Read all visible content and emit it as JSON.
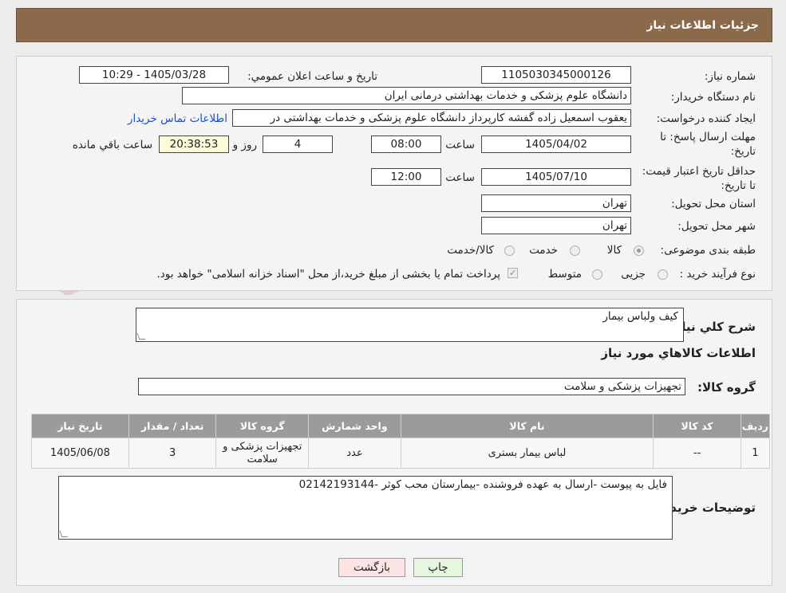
{
  "header": {
    "title": "جزئیات اطلاعات نیاز"
  },
  "form": {
    "need_number_label": "شماره نیاز:",
    "need_number": "1105030345000126",
    "announce_label": "تاریخ و ساعت اعلان عمومي:",
    "announce_value": "1405/03/28 - 10:29",
    "buyer_org_label": "نام دستگاه خریدار:",
    "buyer_org": "دانشگاه علوم پزشکی و خدمات بهداشتی درمانی ایران",
    "creator_label": "ایجاد کننده درخواست:",
    "creator": "یعقوب اسمعیل زاده گفشه کارپرداز دانشگاه علوم پزشکی و خدمات بهداشتی در",
    "contact_link": "اطلاعات تماس خریدار",
    "reply_deadline_label": "مهلت ارسال پاسخ: تا تاریخ:",
    "reply_date": "1405/04/02",
    "time_label": "ساعت",
    "reply_time": "08:00",
    "days": "4",
    "days_label": "روز و",
    "remaining_time": "20:38:53",
    "remaining_label": "ساعت باقي مانده",
    "price_validity_label": "حداقل تاریخ اعتبار قیمت: تا تاریخ:",
    "validity_date": "1405/07/10",
    "validity_time": "12:00",
    "province_label": "استان محل تحویل:",
    "province": "تهران",
    "city_label": "شهر محل تحویل:",
    "city": "تهران",
    "category_label": "طبقه بندی موضوعی:",
    "category_options": [
      "کالا",
      "خدمت",
      "کالا/خدمت"
    ],
    "process_label": "نوع فرآیند خرید :",
    "process_options": [
      "جزیی",
      "متوسط"
    ],
    "payment_note": "پرداخت تمام یا بخشی از مبلغ خرید،از محل \"اسناد خزانه اسلامی\" خواهد بود."
  },
  "details": {
    "summary_label": "شرح کلي نیاز:",
    "summary": "کیف ولباس بیمار",
    "goods_info_title": "اطلاعات کالاهاي مورد نیاز",
    "group_label": "گروه کالا:",
    "group_value": "تجهیزات پزشکی و سلامت",
    "table": {
      "headers": [
        "ردیف",
        "کد کالا",
        "نام کالا",
        "واحد شمارش",
        "گروه کالا",
        "تعداد / مقدار",
        "تاریخ نیاز"
      ],
      "rows": [
        [
          "1",
          "--",
          "لباس بیمار بستری",
          "عدد",
          "تجهیزات پزشکی و سلامت",
          "3",
          "1405/06/08"
        ]
      ]
    },
    "buyer_notes_label": "توضیحات خریدار:",
    "buyer_notes": "فایل به پیوست -ارسال به عهده فروشنده -بیمارستان محب کوثر -02142193144"
  },
  "buttons": {
    "print": "چاپ",
    "back": "بازگشت"
  },
  "colors": {
    "header_bg": "#8b6a4c",
    "table_header_bg": "#9b9b9b",
    "link": "#1d4fc4",
    "back_button_bg": "#fde4e4",
    "print_button_bg": "#e6f7e0"
  }
}
